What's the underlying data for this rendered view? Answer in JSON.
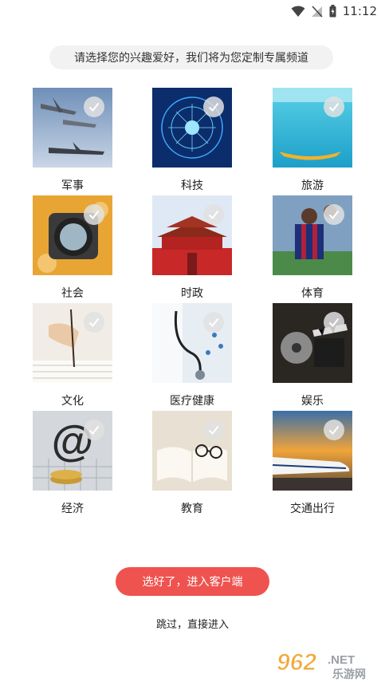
{
  "status_bar": {
    "time": "11:12"
  },
  "prompt_text": "请选择您的兴趣爱好，我们将为您定制专属频道",
  "categories": [
    {
      "label": "军事"
    },
    {
      "label": "科技"
    },
    {
      "label": "旅游"
    },
    {
      "label": "社会"
    },
    {
      "label": "时政"
    },
    {
      "label": "体育"
    },
    {
      "label": "文化"
    },
    {
      "label": "医疗健康"
    },
    {
      "label": "娱乐"
    },
    {
      "label": "经济"
    },
    {
      "label": "教育"
    },
    {
      "label": "交通出行"
    }
  ],
  "enter_button_label": "选好了，进入客户端",
  "skip_label": "跳过，直接进入",
  "watermark": {
    "number": "962",
    "tld": ".NET",
    "cn": "乐游网"
  },
  "colors": {
    "accent": "#ef5350",
    "prompt_bg": "#f2f2f2"
  }
}
